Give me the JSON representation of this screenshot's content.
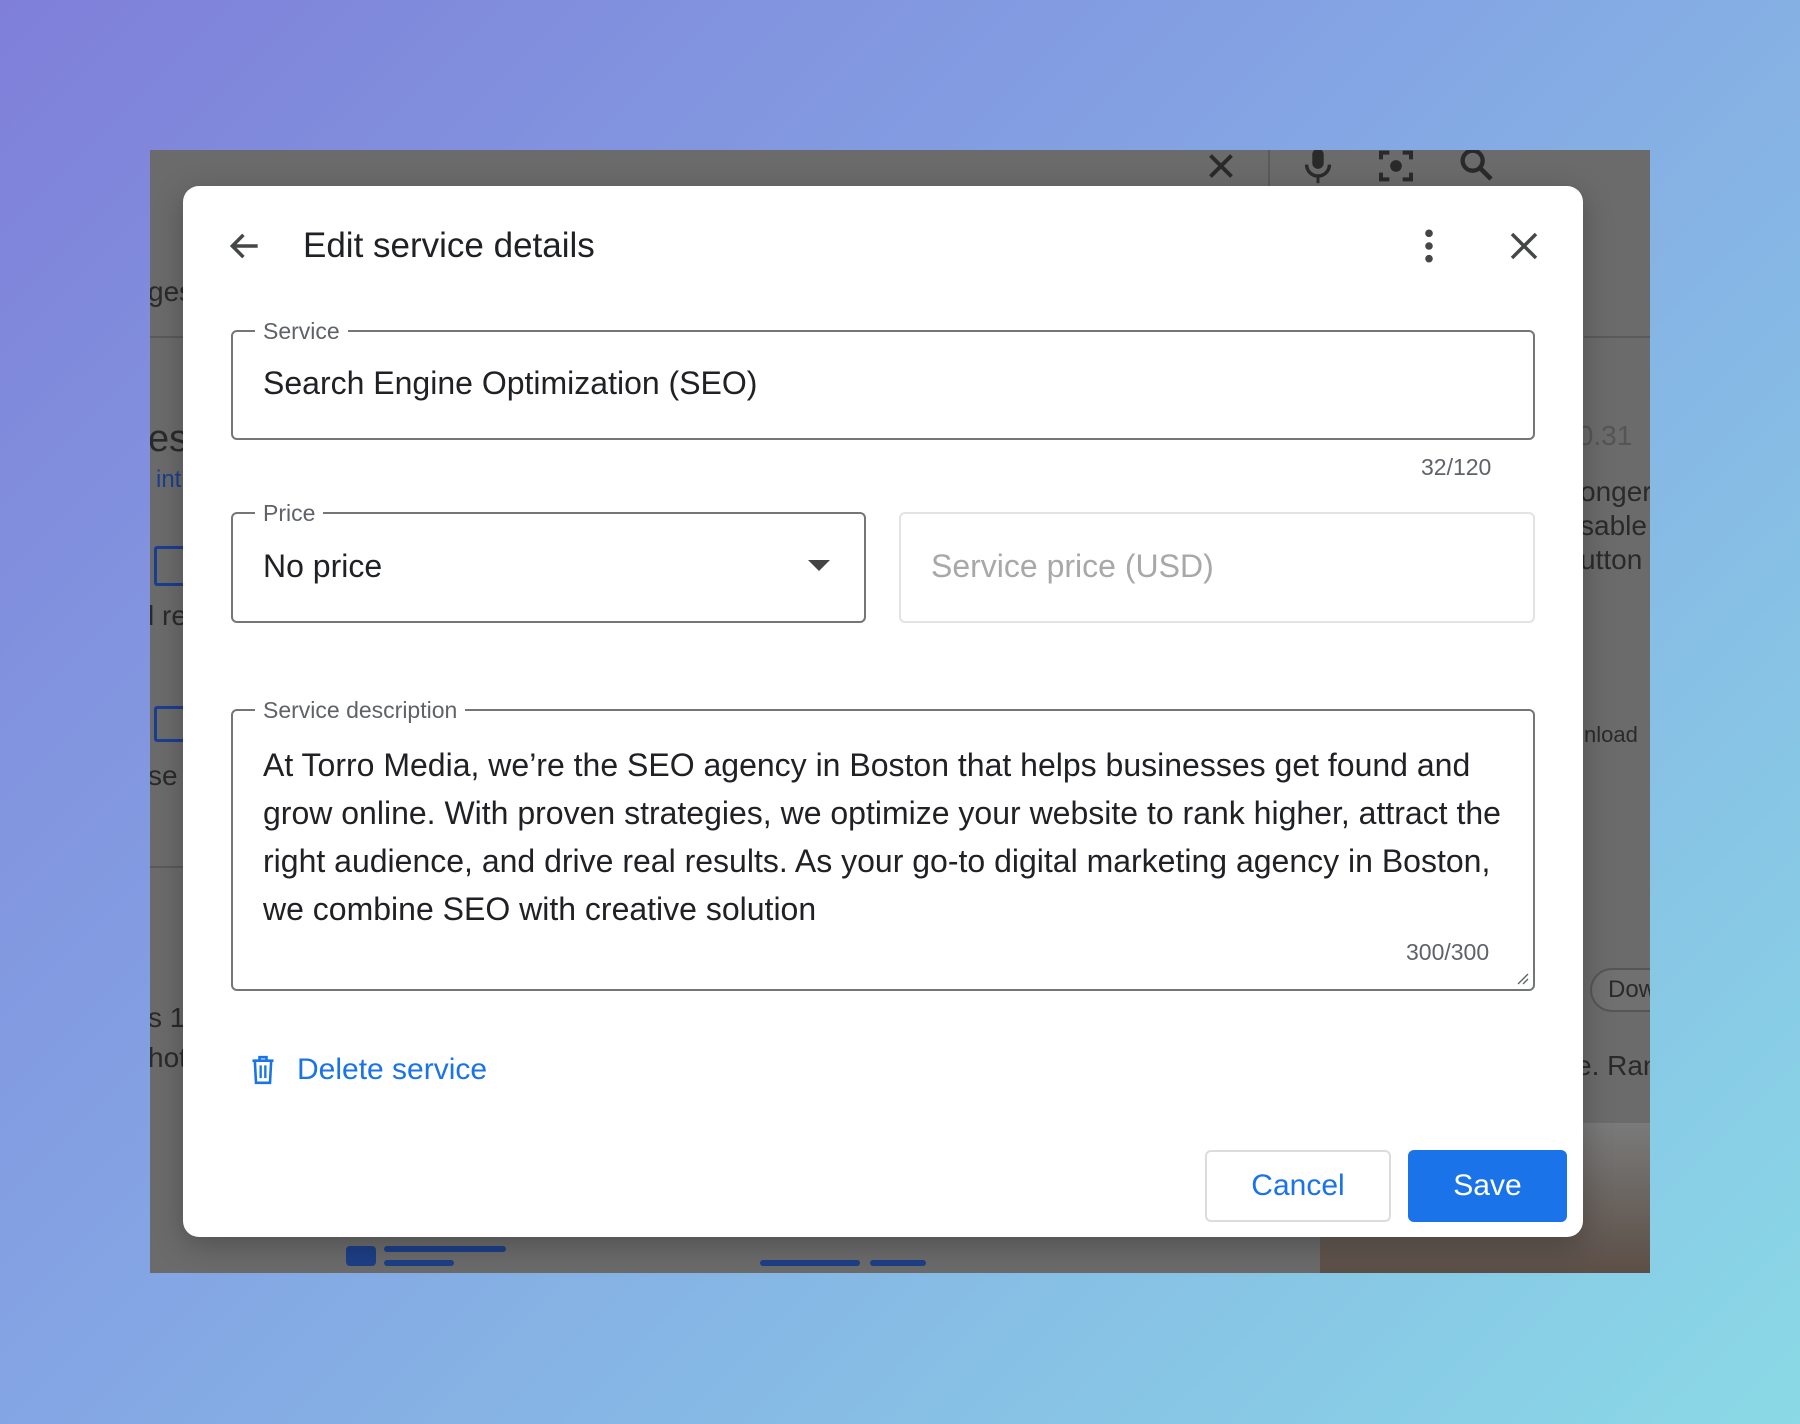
{
  "dialog": {
    "title": "Edit service details",
    "service": {
      "label": "Service",
      "value": "Search Engine Optimization (SEO)",
      "counter": "32/120"
    },
    "price": {
      "label": "Price",
      "selected": "No price"
    },
    "service_price": {
      "placeholder": "Service price (USD)"
    },
    "description": {
      "label": "Service description",
      "value": "At Torro Media, we’re the SEO agency in Boston that helps businesses get found and grow online. With proven strategies, we optimize your website to rank higher, attract the right audience, and drive real results. As your go-to digital marketing agency in Boston, we combine SEO with creative solution",
      "counter": "300/300"
    },
    "delete_label": "Delete service",
    "cancel_label": "Cancel",
    "save_label": "Save"
  },
  "background": {
    "fragments": [
      "ges",
      "es",
      "int",
      "l re",
      "se",
      "s 1",
      "hot",
      ".0.31",
      "onger",
      "sable",
      "utton",
      "nload",
      "Dow",
      "e. Ran"
    ]
  },
  "colors": {
    "accent": "#1a73e8",
    "overlay": "#6b6b6b",
    "dialog_bg": "#ffffff"
  }
}
